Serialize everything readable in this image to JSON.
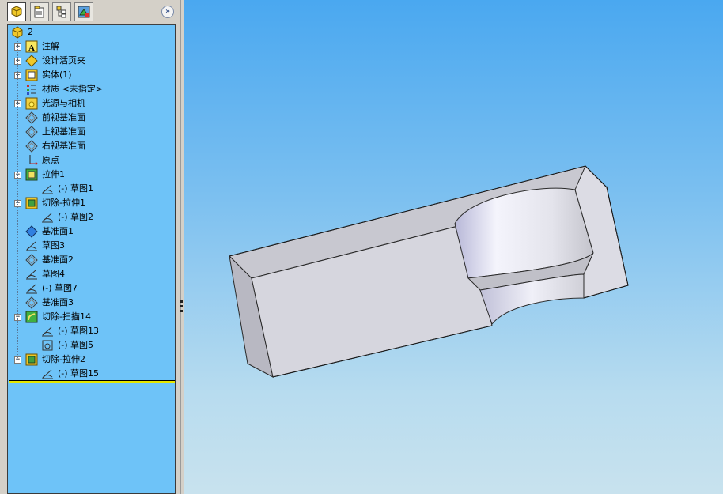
{
  "panel": {
    "tabs": [
      {
        "name": "tab-feature-manager",
        "icon": "feature-manager-icon"
      },
      {
        "name": "tab-property-manager",
        "icon": "property-manager-icon"
      },
      {
        "name": "tab-configuration-manager",
        "icon": "configuration-manager-icon"
      },
      {
        "name": "tab-dimxpert-manager",
        "icon": "dimxpert-manager-icon"
      }
    ],
    "expand_glyph": "»"
  },
  "tree": {
    "root": {
      "label": "2",
      "icon": "part-icon"
    },
    "items": [
      {
        "label": "注解",
        "icon": "annotation-icon",
        "expand": "+",
        "indent": 0
      },
      {
        "label": "设计活页夹",
        "icon": "design-binder-icon",
        "expand": "+",
        "indent": 0
      },
      {
        "label": "实体(1)",
        "icon": "solid-bodies-icon",
        "expand": "+",
        "indent": 0
      },
      {
        "label": "材质 <未指定>",
        "icon": "material-icon",
        "expand": "",
        "indent": 0
      },
      {
        "label": "光源与相机",
        "icon": "lights-cameras-icon",
        "expand": "+",
        "indent": 0
      },
      {
        "label": "前视基准面",
        "icon": "plane-icon",
        "expand": "",
        "indent": 0
      },
      {
        "label": "上视基准面",
        "icon": "plane-icon",
        "expand": "",
        "indent": 0
      },
      {
        "label": "右视基准面",
        "icon": "plane-icon",
        "expand": "",
        "indent": 0
      },
      {
        "label": "原点",
        "icon": "origin-icon",
        "expand": "",
        "indent": 0
      },
      {
        "label": "拉伸1",
        "icon": "extrude-icon",
        "expand": "−",
        "indent": 0
      },
      {
        "label": "(-) 草图1",
        "icon": "sketch-icon",
        "expand": "",
        "indent": 1
      },
      {
        "label": "切除-拉伸1",
        "icon": "cut-extrude-icon",
        "expand": "−",
        "indent": 0
      },
      {
        "label": "(-) 草图2",
        "icon": "sketch-icon",
        "expand": "",
        "indent": 1
      },
      {
        "label": "基准面1",
        "icon": "plane-blue-icon",
        "expand": "",
        "indent": 0
      },
      {
        "label": "草图3",
        "icon": "sketch-icon",
        "expand": "",
        "indent": 0
      },
      {
        "label": "基准面2",
        "icon": "plane-icon",
        "expand": "",
        "indent": 0
      },
      {
        "label": "草图4",
        "icon": "sketch-icon",
        "expand": "",
        "indent": 0
      },
      {
        "label": "(-) 草图7",
        "icon": "sketch-icon",
        "expand": "",
        "indent": 0
      },
      {
        "label": "基准面3",
        "icon": "plane-icon",
        "expand": "",
        "indent": 0
      },
      {
        "label": "切除-扫描14",
        "icon": "cut-sweep-icon",
        "expand": "−",
        "indent": 0
      },
      {
        "label": "(-) 草图13",
        "icon": "sketch-icon",
        "expand": "",
        "indent": 1
      },
      {
        "label": "(-) 草图5",
        "icon": "sketch3d-icon",
        "expand": "",
        "indent": 1
      },
      {
        "label": "切除-拉伸2",
        "icon": "cut-extrude-icon",
        "expand": "−",
        "indent": 0
      },
      {
        "label": "(-) 草图15",
        "icon": "sketch-icon",
        "expand": "",
        "indent": 1
      }
    ]
  },
  "viewport": {
    "background_top": "#4aa8f0",
    "background_bottom": "#c8e2ee",
    "model_color": "#d8d8e0"
  }
}
